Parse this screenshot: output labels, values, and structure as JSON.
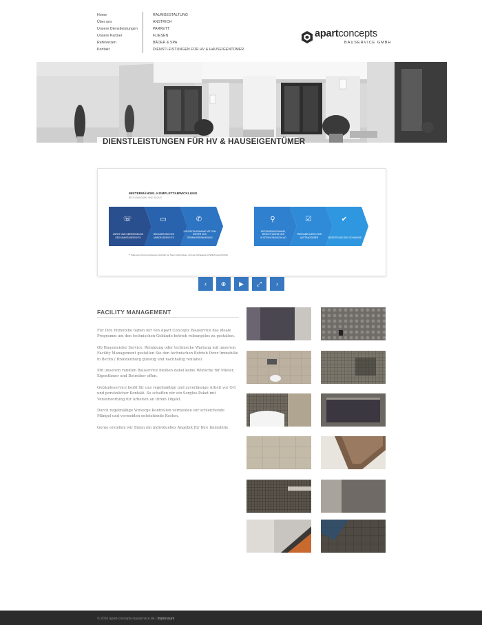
{
  "nav": {
    "left": [
      "Home",
      "Über uns",
      "Unsere Dienstleistungen",
      "Unsere Partner",
      "Referenzen",
      "Kontakt"
    ],
    "right": [
      "RAUMGESTALTUNG",
      "ANSTRICH",
      "PARKETT",
      "FLIESEN",
      "BÄDER & SPA",
      "DIENSTLEISTUNGEN FÜR HV & HAUSEIGENTÜMER"
    ]
  },
  "logo": {
    "word_a": "apart",
    "word_b": "concepts",
    "sub": "BAUSERVICE GMBH"
  },
  "hero": {
    "title": "DIENSTLEISTUNGEN FÜR HV & HAUSEIGENTÜMER"
  },
  "slide": {
    "title": "MIETERMÄNGEL KOMPLETTABWICKLUNG",
    "subtitle": "BEI KÜNDIGUNG UND ZUZUG",
    "steps": [
      {
        "label": "ANRUF UND ÜBERSENDUNG DES MÄNGELBERICHTS",
        "icon": "phone-icon",
        "glyph": "☏",
        "color": "#2a4f8f"
      },
      {
        "label": "BEDAUERUNG DES MÄNGELBERICHTS",
        "icon": "folder-icon",
        "glyph": "▭",
        "color": "#2a63ad"
      },
      {
        "label": "KONTAKTAUFNAHME MIT DEM MIETER UND TERMINVEREINBARUNG",
        "icon": "phone-clock-icon",
        "glyph": "✆",
        "color": "#2d74c2"
      },
      {
        "label": "BESTANDSAUFNAHME, BESICHTIGUNG UND KOSTENVORANSCHLAG",
        "icon": "search-icon",
        "glyph": "⚲",
        "color": "#2f80cf"
      },
      {
        "label": "FREIGABE DURCH DEN AUFTRAGGEBER",
        "icon": "clipboard-icon",
        "glyph": "☑",
        "color": "#2f8bd8"
      },
      {
        "label": "BESEITIGUNG DES SCHADENS",
        "icon": "check-icon",
        "glyph": "✔",
        "color": "#2f97df"
      }
    ],
    "footnote": "** Sollte eine Terminvereinbarung innerhalb von Tagen nicht erfolgen, wird der Auftraggeber schriftlich benachrichtigt."
  },
  "controls": [
    "‹",
    "⊕",
    "▶",
    "⤢",
    "›"
  ],
  "content": {
    "title": "FACILITY MANAGEMENT",
    "paragraphs": [
      "Für Ihre Immobilie haben wir von Apart Concepts Bauservice das ideale Programm um den technischen Gebäude-betrieb reibungslos zu gestalten.",
      "Ob Hausmeister Service, Reinigung oder technische Wartung mit unserem Facility Management gestalten Sie den technischen Betrieb Ihrer Immobilie in Berlin / Brandenburg günstig und nachhaltig rentabel.",
      "Mit unserem rundum Bauservice bleiben dabei keine Wünsche für Mieter, Eigentümer und Betreiber offen.",
      "Gebäudeservice heißt für uns regelmäßige und zuverlässige Arbeit vor Ort und persönlicher Kontakt. So schaffen wir ein Sorglos-Paket mit Verantwortung für Arbeiten an Ihrem Objekt.",
      "Durch regelmäßige Vorsorge Kontrollen vermeiden wir schleichende Mängel und vermeiden entstehende Kosten.",
      "Gerne erstellen wir Ihnen ein individuelles Angebot für Ihre Immobilie."
    ]
  },
  "footer": {
    "copyright": "© 2016 apart-concepts-bauservice.de |",
    "link": "Impressum"
  }
}
